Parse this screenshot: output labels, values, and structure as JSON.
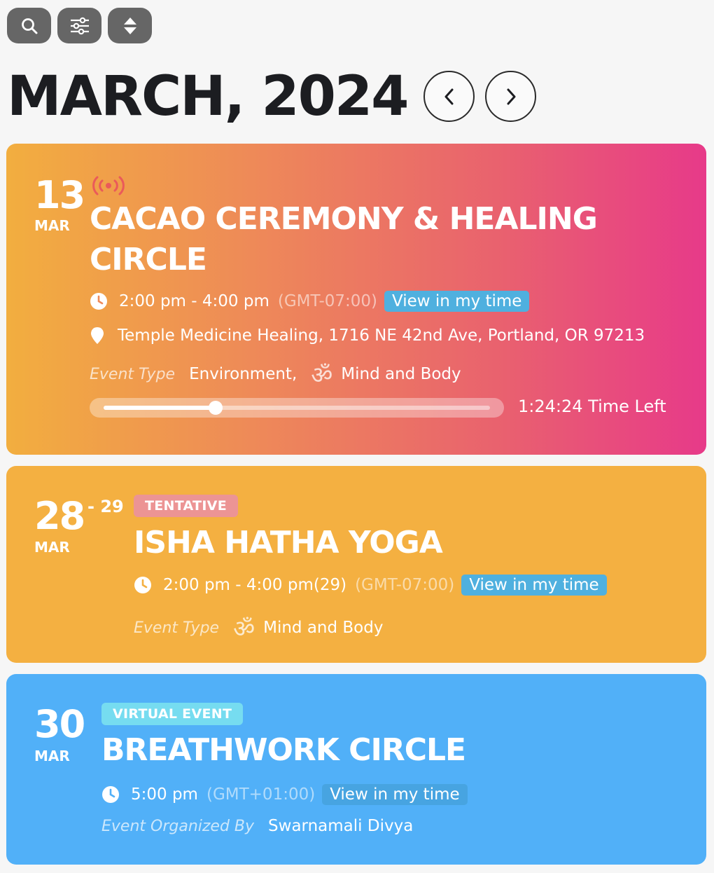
{
  "toolbar": {
    "buttons": [
      {
        "icon": "search-icon"
      },
      {
        "icon": "filter-sliders-icon"
      },
      {
        "icon": "sort-icon"
      }
    ]
  },
  "header": {
    "month_title": "MARCH, 2024",
    "prev_icon": "chevron-left-icon",
    "next_icon": "chevron-right-icon"
  },
  "events": [
    {
      "day": "13",
      "month": "MAR",
      "live_icon": "live-broadcast-icon",
      "title_line1": "CACAO CEREMONY & HEALING",
      "title_line2": "CIRCLE",
      "time": "2:00 pm - 4:00 pm",
      "timezone": "(GMT-07:00)",
      "view_time_label": "View in my time",
      "location": "Temple Medicine Healing, 1716 NE 42nd Ave, Portland, OR 97213",
      "type_label": "Event Type",
      "types": [
        "Environment,",
        "Mind and Body"
      ],
      "progress": 0.29,
      "time_left": "1:24:24 Time Left",
      "gradient": [
        "#f2ae3f",
        "#e73a89"
      ]
    },
    {
      "day": "28",
      "day_end": "- 29",
      "month": "MAR",
      "badge": "TENTATIVE",
      "title": "ISHA HATHA YOGA",
      "time": "2:00 pm - 4:00 pm(29)",
      "timezone": "(GMT-07:00)",
      "view_time_label": "View in my time",
      "type_label": "Event Type",
      "type": "Mind and Body",
      "color": "#f4b041"
    },
    {
      "day": "30",
      "month": "MAR",
      "badge": "VIRTUAL EVENT",
      "title": "BREATHWORK CIRCLE",
      "time": "5:00 pm",
      "timezone": "(GMT+01:00)",
      "view_time_label": "View in my time",
      "organizer_label": "Event Organized By",
      "organizer": "Swarnamali Divya",
      "color": "#51b0f8"
    }
  ],
  "colors": {
    "background": "#f6f6f6",
    "toolbar_button": "#666666",
    "view_time_badge": "#4fb0df",
    "tentative_badge": "#ec9494",
    "virtual_badge": "#76dcf0"
  }
}
